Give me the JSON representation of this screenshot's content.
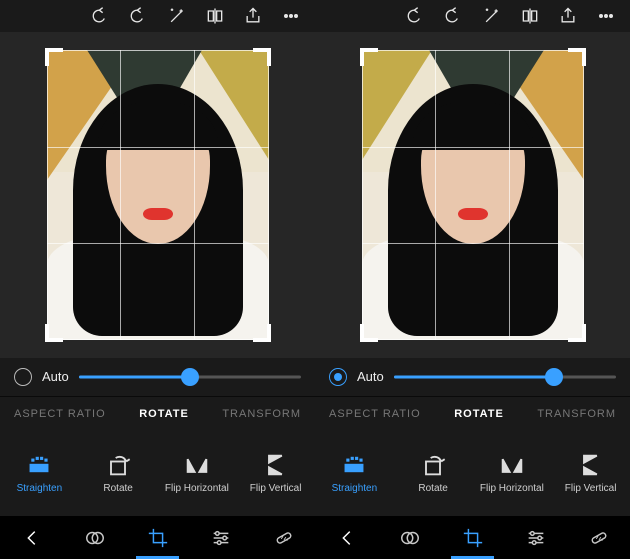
{
  "panes": [
    {
      "auto": {
        "label": "Auto",
        "selected": false,
        "slider_pct": 50
      },
      "tabs": {
        "aspect": "ASPECT RATIO",
        "rotate": "ROTATE",
        "transform": "TRANSFORM",
        "active": "rotate"
      },
      "tools": {
        "straighten": "Straighten",
        "rotate": "Rotate",
        "flip_h": "Flip Horizontal",
        "flip_v": "Flip Vertical",
        "active": "straighten"
      },
      "bottom_active": "crop",
      "mirror": false
    },
    {
      "auto": {
        "label": "Auto",
        "selected": true,
        "slider_pct": 72
      },
      "tabs": {
        "aspect": "ASPECT RATIO",
        "rotate": "ROTATE",
        "transform": "TRANSFORM",
        "active": "rotate"
      },
      "tools": {
        "straighten": "Straighten",
        "rotate": "Rotate",
        "flip_h": "Flip Horizontal",
        "flip_v": "Flip Vertical",
        "active": "straighten"
      },
      "bottom_active": "crop",
      "mirror": true
    }
  ],
  "colors": {
    "accent": "#39a0ff",
    "bg": "#1a1a1a"
  }
}
